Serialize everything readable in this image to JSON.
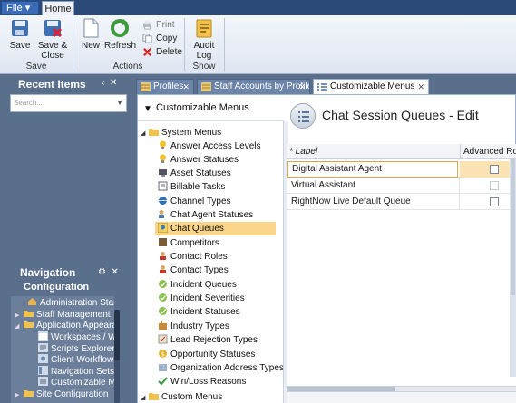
{
  "menu": {
    "file": "File ▾",
    "home": "Home"
  },
  "ribbon": {
    "save": "Save",
    "save_close": "Save &\nClose",
    "group_save": "Save",
    "new": "New",
    "refresh": "Refresh",
    "print": "Print",
    "copy": "Copy",
    "delete": "Delete",
    "group_actions": "Actions",
    "audit_log": "Audit\nLog",
    "group_show": "Show"
  },
  "recent": {
    "title": "Recent Items",
    "search_placeholder": "Search..."
  },
  "navigation": {
    "title": "Navigation",
    "section": "Configuration",
    "items": [
      "Administration Start P",
      "Staff Management",
      "Application Appearan",
      "Workspaces / Wor",
      "Scripts Explorer",
      "Client Workflow Ir",
      "Navigation Sets",
      "Customizable Mer",
      "Site Configuration"
    ]
  },
  "doc_tabs": [
    "Profiles",
    "Staff Accounts by Profile",
    "Customizable Menus"
  ],
  "tree": {
    "header": "Customizable Menus",
    "system_menus": "System Menus",
    "items": [
      "Answer Access Levels",
      "Answer Statuses",
      "Asset Statuses",
      "Billable Tasks",
      "Channel Types",
      "Chat Agent Statuses",
      "Chat Queues",
      "Competitors",
      "Contact Roles",
      "Contact Types",
      "Incident Queues",
      "Incident Severities",
      "Incident Statuses",
      "Industry Types",
      "Lead Rejection Types",
      "Opportunity Statuses",
      "Organization Address Types",
      "Win/Loss Reasons"
    ],
    "custom_menus": "Custom Menus"
  },
  "editor": {
    "title": "Chat Session Queues - Edit",
    "col_label": "* Label",
    "col_advanced": "Advanced Ro",
    "rows": [
      "Digital Assistant Agent",
      "Virtual Assistant",
      "RightNow Live Default Queue"
    ]
  },
  "colors": {
    "accent": "#2b4a78",
    "selection": "#fbd68a",
    "panel": "#5a6f8c"
  }
}
